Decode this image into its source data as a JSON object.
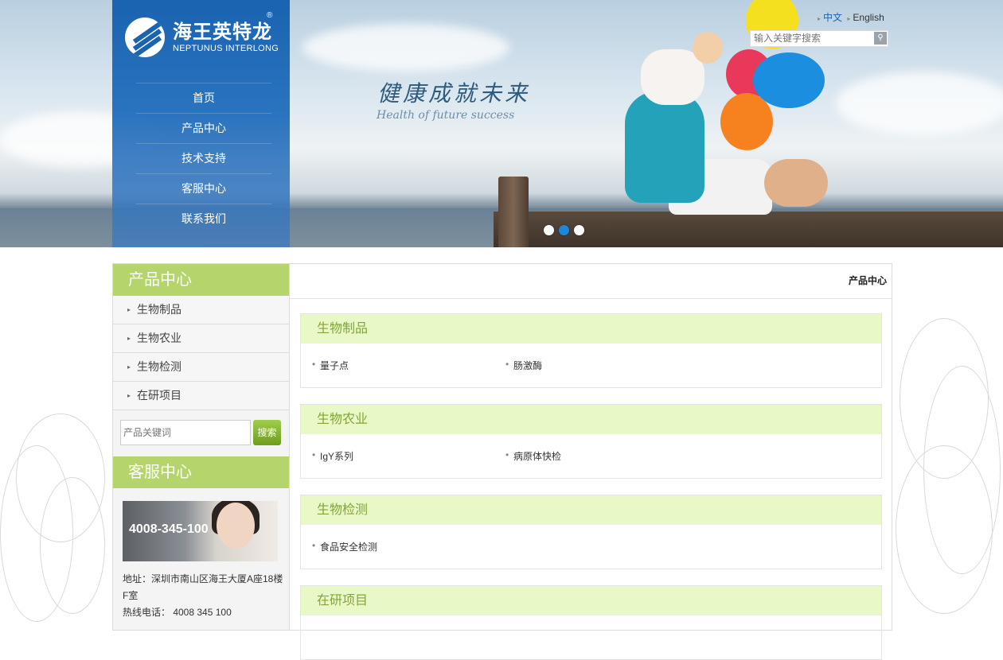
{
  "header": {
    "logo_cn": "海王英特龙",
    "logo_en": "NEPTUNUS INTERLONG",
    "registered": "®",
    "nav": [
      "首页",
      "产品中心",
      "技术支持",
      "客服中心",
      "联系我们"
    ],
    "lang_cn": "中文",
    "lang_en": "English",
    "search_placeholder": "输入关键字搜索"
  },
  "banner": {
    "slogan_cn": "健康成就未来",
    "slogan_en": "Health of future success",
    "slides": 3,
    "active_slide": 2
  },
  "sidebar": {
    "product_title": "产品中心",
    "product_items": [
      "生物制品",
      "生物农业",
      "生物检测",
      "在研项目"
    ],
    "search_placeholder": "产品关键词",
    "search_button": "搜索",
    "service_title": "客服中心",
    "service_phone_banner": "4008-345-100",
    "address": "地址：深圳市南山区海王大厦A座18楼F室",
    "hotline": "热线电话：  4008   345   100"
  },
  "main": {
    "breadcrumb": "产品中心",
    "categories": [
      {
        "title": "生物制品",
        "items": [
          "量子点",
          "肠激酶"
        ]
      },
      {
        "title": "生物农业",
        "items": [
          "IgY系列",
          "病原体快检"
        ]
      },
      {
        "title": "生物检测",
        "items": [
          "食品安全检测"
        ]
      },
      {
        "title": "在研项目",
        "items": []
      }
    ]
  },
  "colors": {
    "nav_blue": "#1a63b0",
    "sidebar_green": "#b5d56c",
    "category_bg": "#e8f8c6",
    "category_text": "#82a53a"
  }
}
